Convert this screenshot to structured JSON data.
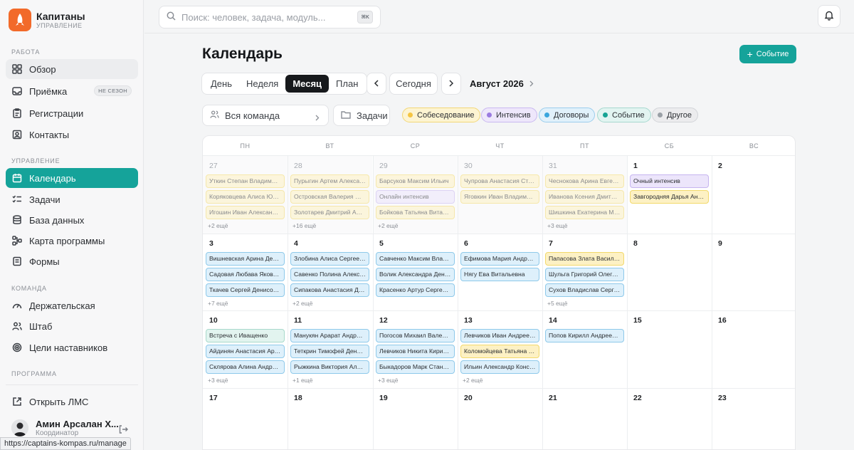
{
  "brand": {
    "name": "Капитаны",
    "subtitle": "УПРАВЛЕНИЕ"
  },
  "sidebar": {
    "section_work": "РАБОТА",
    "section_management": "УПРАВЛЕНИЕ",
    "section_team": "КОМАНДА",
    "section_program": "ПРОГРАММА",
    "items": [
      {
        "label": "Обзор",
        "icon": "grid-icon"
      },
      {
        "label": "Приёмка",
        "icon": "inbox-icon",
        "badge": "НЕ СЕЗОН"
      },
      {
        "label": "Регистрации",
        "icon": "clipboard-icon"
      },
      {
        "label": "Контакты",
        "icon": "contact-icon"
      },
      {
        "label": "Календарь",
        "icon": "calendar-icon"
      },
      {
        "label": "Задачи",
        "icon": "tasks-icon"
      },
      {
        "label": "База данных",
        "icon": "database-icon"
      },
      {
        "label": "Карта программы",
        "icon": "map-icon"
      },
      {
        "label": "Формы",
        "icon": "forms-icon"
      },
      {
        "label": "Держательская",
        "icon": "gauge-icon"
      },
      {
        "label": "Штаб",
        "icon": "people-icon"
      },
      {
        "label": "Цели наставников",
        "icon": "target-icon"
      }
    ],
    "open_lms": "Открыть ЛМС",
    "user_name": "Амин Арсалан Х...",
    "user_role": "Координатор",
    "status_url": "https://captains-kompas.ru/manage"
  },
  "topbar": {
    "search_placeholder": "Поиск: человек, задача, модуль...",
    "shortcut": "⌘K"
  },
  "page": {
    "title": "Календарь",
    "new_event": "Событие",
    "views": [
      "День",
      "Неделя",
      "Месяц",
      "План"
    ],
    "active_view": "Месяц",
    "today": "Сегодня",
    "month_label": "Август 2026",
    "team_filter": "Вся команда",
    "tasks_filter": "Задачи",
    "chips": [
      {
        "label": "Собеседование",
        "color": "#f5c542",
        "bg": "#fdf4d2",
        "border": "#f2d777"
      },
      {
        "label": "Интенсив",
        "color": "#9b7be0",
        "bg": "#eee7fb",
        "border": "#c9b8f0"
      },
      {
        "label": "Договоры",
        "color": "#3aa6dd",
        "bg": "#e1f1fb",
        "border": "#9bcdec"
      },
      {
        "label": "Событие",
        "color": "#17a394",
        "bg": "#e2f4f1",
        "border": "#a6d8cf"
      },
      {
        "label": "Другое",
        "color": "#9aa0a6",
        "bg": "#ececee",
        "border": "#d2d4d8"
      }
    ]
  },
  "calendar": {
    "weekdays": [
      "ПН",
      "ВТ",
      "СР",
      "ЧТ",
      "ПТ",
      "СБ",
      "ВС"
    ],
    "weeks": [
      [
        {
          "day": "27",
          "muted": true,
          "events": [
            {
              "t": "Уткин Степан Владимирович",
              "c": "yellow"
            },
            {
              "t": "Коряковцева Алиса Юрьевна",
              "c": "yellow"
            },
            {
              "t": "Игошин Иван Александрович",
              "c": "yellow"
            }
          ],
          "more": "+2 ещё"
        },
        {
          "day": "28",
          "muted": true,
          "events": [
            {
              "t": "Пурыгин Артем Александрович",
              "c": "yellow"
            },
            {
              "t": "Островская Валерия Михайловна",
              "c": "yellow"
            },
            {
              "t": "Золотарев Дмитрий Александрович",
              "c": "yellow"
            }
          ],
          "more": "+16 ещё"
        },
        {
          "day": "29",
          "muted": true,
          "events": [
            {
              "t": "Барсуков Максим Ильич",
              "c": "yellow"
            },
            {
              "t": "Онлайн интенсив",
              "c": "purple"
            },
            {
              "t": "Бойкова Татьяна Витальевна",
              "c": "yellow"
            }
          ],
          "more": "+2 ещё"
        },
        {
          "day": "30",
          "muted": true,
          "events": [
            {
              "t": "Чупрова Анастасия Степановна",
              "c": "yellow"
            },
            {
              "t": "Яговкин Иван Владимирович",
              "c": "yellow"
            }
          ],
          "more": ""
        },
        {
          "day": "31",
          "muted": true,
          "events": [
            {
              "t": "Чеснокова Арина Евгеньевна",
              "c": "yellow"
            },
            {
              "t": "Иванова Ксения Дмитриевна",
              "c": "yellow"
            },
            {
              "t": "Шишкина Екатерина Максимовна",
              "c": "yellow"
            }
          ],
          "more": "+3 ещё"
        },
        {
          "day": "1",
          "muted": false,
          "events": [
            {
              "t": "Очный интенсив",
              "c": "purple"
            },
            {
              "t": "Завгородняя Дарья Андреевна",
              "c": "yellow"
            }
          ],
          "more": ""
        },
        {
          "day": "2",
          "muted": false,
          "events": [],
          "more": ""
        }
      ],
      [
        {
          "day": "3",
          "muted": false,
          "events": [
            {
              "t": "Вишневская Арина Денисовна",
              "c": "blue"
            },
            {
              "t": "Садовая Любава Яковлевна",
              "c": "blue"
            },
            {
              "t": "Ткачев Сергей Денисович",
              "c": "blue"
            }
          ],
          "more": "+7 ещё"
        },
        {
          "day": "4",
          "muted": false,
          "events": [
            {
              "t": "Злобина Алиса Сергеевна",
              "c": "blue"
            },
            {
              "t": "Савенко Полина Алексеевна",
              "c": "blue"
            },
            {
              "t": "Сипакова Анастасия Дмитриевна",
              "c": "blue"
            }
          ],
          "more": "+2 ещё"
        },
        {
          "day": "5",
          "muted": false,
          "events": [
            {
              "t": "Савченко Максим Владимирович",
              "c": "blue"
            },
            {
              "t": "Волик Александра Денисовна",
              "c": "blue"
            },
            {
              "t": "Красенко Артур Сергеевич",
              "c": "blue"
            }
          ],
          "more": ""
        },
        {
          "day": "6",
          "muted": false,
          "events": [
            {
              "t": "Ефимова Мария Андреевна",
              "c": "blue"
            },
            {
              "t": "Нягу Ева Витальевна",
              "c": "blue"
            }
          ],
          "more": ""
        },
        {
          "day": "7",
          "muted": false,
          "events": [
            {
              "t": "Папасова Злата Васильевна",
              "c": "yellow"
            },
            {
              "t": "Шульга Григорий Олегович",
              "c": "blue"
            },
            {
              "t": "Сухов Владислав Сергеевич",
              "c": "blue"
            }
          ],
          "more": "+5 ещё"
        },
        {
          "day": "8",
          "muted": false,
          "events": [],
          "more": ""
        },
        {
          "day": "9",
          "muted": false,
          "events": [],
          "more": ""
        }
      ],
      [
        {
          "day": "10",
          "muted": false,
          "events": [
            {
              "t": "Встреча с Иващенко",
              "c": "green"
            },
            {
              "t": "Айдинян Анастасия Артуровна",
              "c": "blue"
            },
            {
              "t": "Склярова Алина Андреевна",
              "c": "blue"
            }
          ],
          "more": "+3 ещё"
        },
        {
          "day": "11",
          "muted": false,
          "events": [
            {
              "t": "Манукян Арарат Андраникович",
              "c": "blue"
            },
            {
              "t": "Теткрин Тимофей Денисович",
              "c": "blue"
            },
            {
              "t": "Рыжкина Виктория Алексеевна",
              "c": "blue"
            }
          ],
          "more": "+1 ещё"
        },
        {
          "day": "12",
          "muted": false,
          "events": [
            {
              "t": "Погосов Михаил Валерьевич",
              "c": "blue"
            },
            {
              "t": "Левчиков Никита Кириллович",
              "c": "blue"
            },
            {
              "t": "Быкадоров Марк Станиславович",
              "c": "blue"
            }
          ],
          "more": "+3 ещё"
        },
        {
          "day": "13",
          "muted": false,
          "events": [
            {
              "t": "Левчиков Иван Андреевич",
              "c": "blue"
            },
            {
              "t": "Коломойцева Татьяна Евгеньевна",
              "c": "yellow"
            },
            {
              "t": "Ильин Александр Константинович",
              "c": "blue"
            }
          ],
          "more": "+2 ещё"
        },
        {
          "day": "14",
          "muted": false,
          "events": [
            {
              "t": "Попов Кирилл Андреевич",
              "c": "blue"
            }
          ],
          "more": ""
        },
        {
          "day": "15",
          "muted": false,
          "events": [],
          "more": ""
        },
        {
          "day": "16",
          "muted": false,
          "events": [],
          "more": ""
        }
      ],
      [
        {
          "day": "17",
          "muted": false,
          "events": [],
          "more": ""
        },
        {
          "day": "18",
          "muted": false,
          "events": [],
          "more": ""
        },
        {
          "day": "19",
          "muted": false,
          "events": [],
          "more": ""
        },
        {
          "day": "20",
          "muted": false,
          "events": [],
          "more": ""
        },
        {
          "day": "21",
          "muted": false,
          "events": [],
          "more": ""
        },
        {
          "day": "22",
          "muted": false,
          "events": [],
          "more": ""
        },
        {
          "day": "23",
          "muted": false,
          "events": [],
          "more": ""
        }
      ]
    ]
  }
}
